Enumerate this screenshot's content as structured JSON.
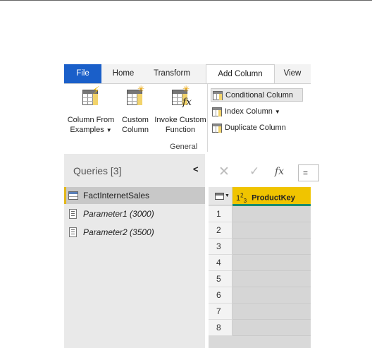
{
  "ribbon": {
    "tabs": [
      "File",
      "Home",
      "Transform",
      "Add Column",
      "View"
    ],
    "active_tab": "Add Column",
    "general_group": {
      "label": "General",
      "column_from_examples": {
        "line1": "Column From",
        "line2": "Examples",
        "icon": "table-lightning-icon"
      },
      "custom_column": {
        "line1": "Custom",
        "line2": "Column",
        "icon": "table-star-icon"
      },
      "invoke_custom_function": {
        "line1": "Invoke Custom",
        "line2": "Function",
        "icon": "table-fx-icon"
      }
    },
    "small_buttons": {
      "conditional_column": "Conditional Column",
      "index_column": "Index Column",
      "duplicate_column": "Duplicate Column"
    }
  },
  "queries": {
    "title": "Queries [3]",
    "items": [
      {
        "label": "FactInternetSales",
        "type": "table",
        "selected": true
      },
      {
        "label": "Parameter1 (3000)",
        "type": "parameter",
        "selected": false
      },
      {
        "label": "Parameter2 (3500)",
        "type": "parameter",
        "selected": false
      }
    ]
  },
  "formula_bar": {
    "fx": "fx",
    "value": "="
  },
  "grid": {
    "column_type_main": "1",
    "column_type_sup": "2",
    "column_type_sub": "3",
    "column_header": "ProductKey",
    "row_numbers": [
      "1",
      "2",
      "3",
      "4",
      "5",
      "6",
      "7",
      "8"
    ]
  },
  "colors": {
    "file_tab": "#1a5fc9",
    "column_header": "#f0c400",
    "quality_bar": "#1b8c6e",
    "selected_query_accent": "#e3b719"
  }
}
